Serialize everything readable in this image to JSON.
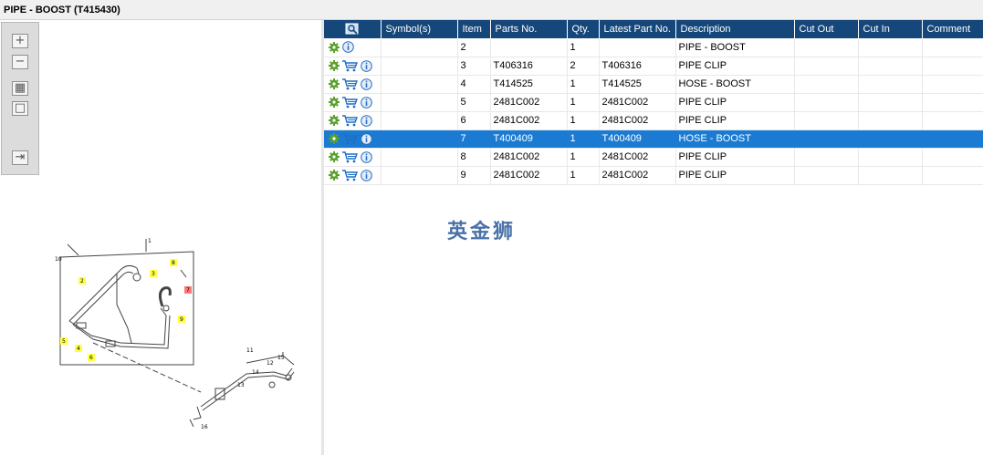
{
  "window": {
    "title": "PIPE - BOOST (T415430)"
  },
  "toolbar": {
    "buttons": [
      {
        "name": "zoom-in",
        "glyph": "+"
      },
      {
        "name": "zoom-out",
        "glyph": "−"
      },
      {
        "name": "fit-page",
        "glyph": "▦"
      },
      {
        "name": "actual-size",
        "glyph": "□"
      },
      {
        "name": "toggle-panel",
        "glyph": "⇥"
      }
    ]
  },
  "diagram": {
    "callouts": [
      "1",
      "2",
      "3",
      "4",
      "5",
      "6",
      "7",
      "8",
      "9",
      "10",
      "11",
      "12",
      "13",
      "14",
      "15",
      "16"
    ]
  },
  "table": {
    "headers": [
      "",
      "Symbol(s)",
      "Item",
      "Parts No.",
      "Qty.",
      "Latest Part No.",
      "Description",
      "Cut Out",
      "Cut In",
      "Comment"
    ],
    "rows": [
      {
        "item": "2",
        "parts_no": "",
        "qty": "1",
        "latest": "",
        "description": "PIPE - BOOST",
        "cart": false,
        "selected": false
      },
      {
        "item": "3",
        "parts_no": "T406316",
        "qty": "2",
        "latest": "T406316",
        "description": "PIPE CLIP",
        "cart": true,
        "selected": false
      },
      {
        "item": "4",
        "parts_no": "T414525",
        "qty": "1",
        "latest": "T414525",
        "description": "HOSE - BOOST",
        "cart": true,
        "selected": false
      },
      {
        "item": "5",
        "parts_no": "2481C002",
        "qty": "1",
        "latest": "2481C002",
        "description": "PIPE CLIP",
        "cart": true,
        "selected": false
      },
      {
        "item": "6",
        "parts_no": "2481C002",
        "qty": "1",
        "latest": "2481C002",
        "description": "PIPE CLIP",
        "cart": true,
        "selected": false
      },
      {
        "item": "7",
        "parts_no": "T400409",
        "qty": "1",
        "latest": "T400409",
        "description": "HOSE - BOOST",
        "cart": true,
        "selected": true
      },
      {
        "item": "8",
        "parts_no": "2481C002",
        "qty": "1",
        "latest": "2481C002",
        "description": "PIPE CLIP",
        "cart": true,
        "selected": false
      },
      {
        "item": "9",
        "parts_no": "2481C002",
        "qty": "1",
        "latest": "2481C002",
        "description": "PIPE CLIP",
        "cart": true,
        "selected": false
      }
    ]
  },
  "watermark": {
    "text": "英金狮"
  },
  "colors": {
    "header": "#16477a",
    "selected": "#1b7bd3",
    "highlight": "#ffff44",
    "highlight_red": "#ff7777"
  }
}
